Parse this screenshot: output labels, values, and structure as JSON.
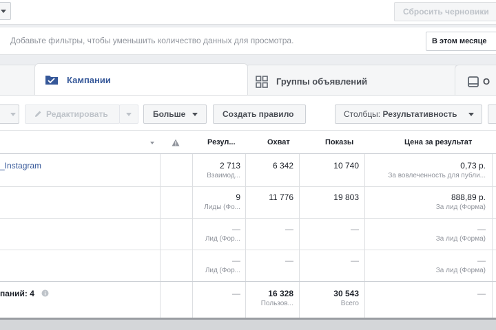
{
  "topbar": {
    "reset_drafts_label": "Сбросить черновики"
  },
  "filterbar": {
    "hint": "Добавьте фильтры, чтобы уменьшить количество данных для просмотра.",
    "date_range_label": "В этом месяце"
  },
  "tabs": {
    "campaigns": "Кампании",
    "adsets": "Группы объявлений",
    "ads": "О"
  },
  "toolbar": {
    "edit_label": "Редактировать",
    "more_label": "Больше",
    "create_rule_label": "Создать правило",
    "columns_prefix": "Столбцы:",
    "columns_value": "Результативность"
  },
  "table": {
    "headers": {
      "results": "Резул...",
      "reach": "Охват",
      "impressions": "Показы",
      "cost_per_result": "Цена за результат"
    },
    "rows": [
      {
        "name": "_Instagram",
        "results": "2 713",
        "results_sub": "Взаимод...",
        "reach": "6 342",
        "impressions": "10 740",
        "cost": "0,73 р.",
        "cost_sub": "За вовлеченность для публи..."
      },
      {
        "name": "",
        "results": "9",
        "results_sub": "Лиды (Фо...",
        "reach": "11 776",
        "impressions": "19 803",
        "cost": "888,89 р.",
        "cost_sub": "За лид (Форма)"
      },
      {
        "name": "",
        "results": "—",
        "results_sub": "Лид (Фор...",
        "reach": "—",
        "impressions": "—",
        "cost": "—",
        "cost_sub": "За лид (Форма)"
      },
      {
        "name": "",
        "results": "—",
        "results_sub": "Лид (Фор...",
        "reach": "—",
        "impressions": "—",
        "cost": "—",
        "cost_sub": "За лид (Форма)"
      }
    ],
    "total": {
      "label": "паний: 4",
      "results": "—",
      "reach": "16 328",
      "reach_sub": "Пользов...",
      "impressions": "30 543",
      "impressions_sub": "Всего",
      "cost": "—"
    }
  },
  "colors": {
    "link": "#365899",
    "muted": "#90949c",
    "border": "#dddfe2"
  }
}
